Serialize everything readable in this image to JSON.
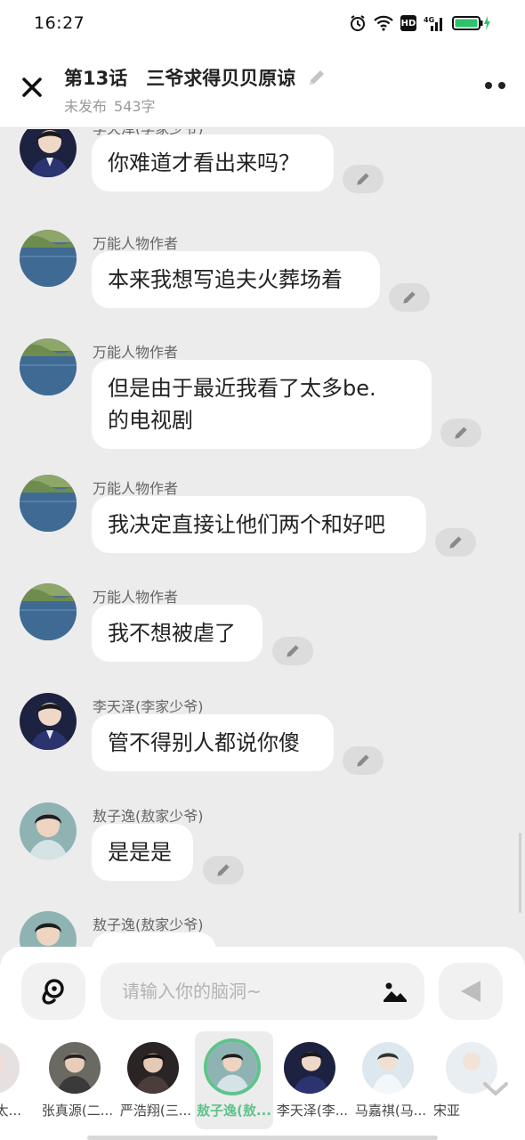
{
  "status_bar": {
    "time": "16:27",
    "hd_label": "HD",
    "network_label": "4G"
  },
  "header": {
    "title": "第13话　三爷求得贝贝原谅",
    "status": "未发布",
    "word_count": "543字"
  },
  "messages": [
    {
      "sender": "李天泽(李家少爷)",
      "text": "你难道才看出来吗？",
      "avatar": "li-tianze"
    },
    {
      "sender": "万能人物作者",
      "text": "本来我想写追夫火葬场着",
      "avatar": "author"
    },
    {
      "sender": "万能人物作者",
      "line1": "但是由于最近我看了太多be.",
      "line2": "的电视剧",
      "avatar": "author"
    },
    {
      "sender": "万能人物作者",
      "text": "我决定直接让他们两个和好吧",
      "avatar": "author"
    },
    {
      "sender": "万能人物作者",
      "text": "我不想被虐了",
      "avatar": "author"
    },
    {
      "sender": "李天泽(李家少爷)",
      "text": "管不得别人都说你傻",
      "avatar": "li-tianze"
    },
    {
      "sender": "敖子逸(敖家少爷)",
      "text": "是是是",
      "avatar": "ao-ziyi"
    },
    {
      "sender": "敖子逸(敖家少爷)",
      "text": "",
      "avatar": "ao-ziyi"
    }
  ],
  "input": {
    "placeholder": "请输入你的脑洞~",
    "value": ""
  },
  "characters": [
    {
      "name": "(太..."
    },
    {
      "name": "张真源(二..."
    },
    {
      "name": "严浩翔(三..."
    },
    {
      "name": "敖子逸(敖...",
      "selected": true
    },
    {
      "name": "李天泽(李..."
    },
    {
      "name": "马嘉祺(马..."
    },
    {
      "name": "宋亚"
    }
  ],
  "colors": {
    "accent": "#5fc38c",
    "background": "#ececec",
    "bubble": "#ffffff"
  }
}
